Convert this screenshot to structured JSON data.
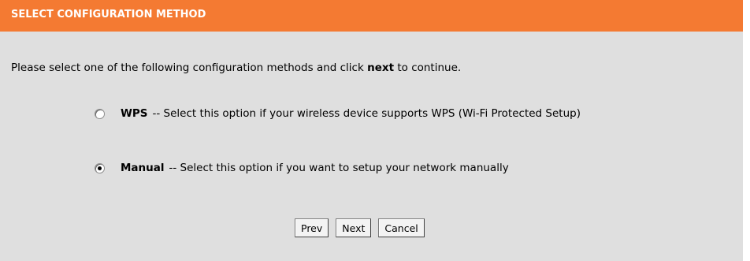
{
  "header": {
    "title": "SELECT CONFIGURATION METHOD"
  },
  "intro": {
    "prefix": "Please select one of the following configuration methods and click",
    "keyword": "next",
    "suffix": "to continue."
  },
  "options": [
    {
      "label": "WPS",
      "description": "-- Select this option if your wireless device supports WPS (Wi-Fi Protected Setup)",
      "checked": false
    },
    {
      "label": "Manual",
      "description": "-- Select this option if you want to setup your network manually",
      "checked": true
    }
  ],
  "buttons": {
    "prev": "Prev",
    "next": "Next",
    "cancel": "Cancel"
  },
  "colors": {
    "header_bg": "#f47a32",
    "panel_bg": "#dfdfdf"
  }
}
